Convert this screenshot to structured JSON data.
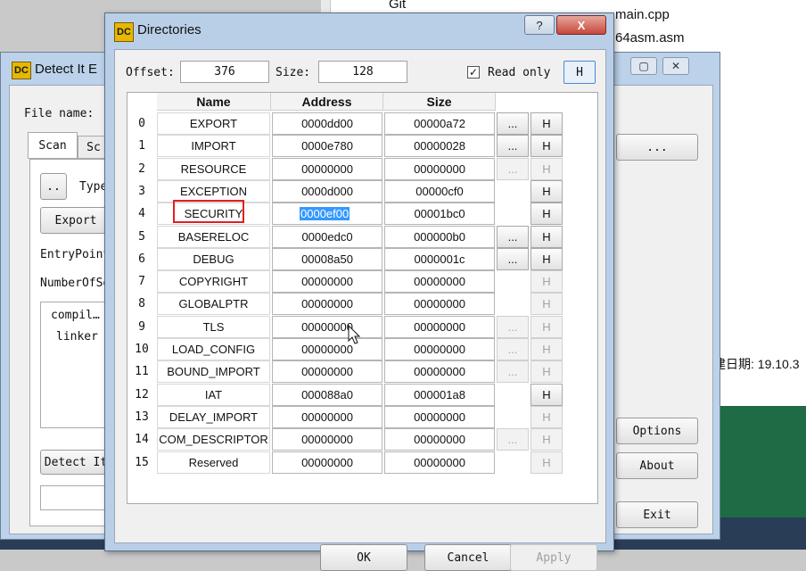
{
  "background": {
    "files": [
      {
        "label": "Git"
      },
      {
        "label": "main.cpp"
      },
      {
        "label": "64asm.asm"
      }
    ],
    "date_text": "建日期: 19.10.3"
  },
  "die_window": {
    "title": "Detect It E",
    "file_name_label": "File name:",
    "tabs": [
      "Scan",
      "Sc"
    ],
    "browse_label": "..",
    "type_label": "Type",
    "export_label": "Export",
    "entrypoint_label": "EntryPoint",
    "numberofsections_label": "NumberOfSe",
    "list_items": [
      "compil…",
      "linker"
    ],
    "detect_label": "Detect It",
    "dots_label": "...",
    "options_label": "Options",
    "about_label": "About",
    "exit_label": "Exit"
  },
  "dialog": {
    "title": "Directories",
    "help_label": "?",
    "close_label": "X",
    "offset_label": "Offset:",
    "offset_value": "376",
    "size_label": "Size:",
    "size_value": "128",
    "readonly_checked": true,
    "readonly_label": "Read only",
    "h_label": "H",
    "columns": [
      "Name",
      "Address",
      "Size"
    ],
    "rows": [
      {
        "idx": "0",
        "name": "EXPORT",
        "address": "0000dd00",
        "size": "00000a72",
        "dots": "enabled",
        "h": "enabled"
      },
      {
        "idx": "1",
        "name": "IMPORT",
        "address": "0000e780",
        "size": "00000028",
        "dots": "enabled",
        "h": "enabled"
      },
      {
        "idx": "2",
        "name": "RESOURCE",
        "address": "00000000",
        "size": "00000000",
        "dots": "disabled",
        "h": "disabled"
      },
      {
        "idx": "3",
        "name": "EXCEPTION",
        "address": "0000d000",
        "size": "00000cf0",
        "dots": "none",
        "h": "enabled"
      },
      {
        "idx": "4",
        "name": "SECURITY",
        "address": "0000ef00",
        "size": "00001bc0",
        "dots": "none",
        "h": "enabled"
      },
      {
        "idx": "5",
        "name": "BASERELOC",
        "address": "0000edc0",
        "size": "000000b0",
        "dots": "enabled",
        "h": "enabled"
      },
      {
        "idx": "6",
        "name": "DEBUG",
        "address": "00008a50",
        "size": "0000001c",
        "dots": "enabled",
        "h": "enabled"
      },
      {
        "idx": "7",
        "name": "COPYRIGHT",
        "address": "00000000",
        "size": "00000000",
        "dots": "none",
        "h": "disabled"
      },
      {
        "idx": "8",
        "name": "GLOBALPTR",
        "address": "00000000",
        "size": "00000000",
        "dots": "none",
        "h": "disabled"
      },
      {
        "idx": "9",
        "name": "TLS",
        "address": "00000000",
        "size": "00000000",
        "dots": "disabled",
        "h": "disabled"
      },
      {
        "idx": "10",
        "name": "LOAD_CONFIG",
        "address": "00000000",
        "size": "00000000",
        "dots": "disabled",
        "h": "disabled"
      },
      {
        "idx": "11",
        "name": "BOUND_IMPORT",
        "address": "00000000",
        "size": "00000000",
        "dots": "disabled",
        "h": "disabled"
      },
      {
        "idx": "12",
        "name": "IAT",
        "address": "000088a0",
        "size": "000001a8",
        "dots": "none",
        "h": "enabled"
      },
      {
        "idx": "13",
        "name": "DELAY_IMPORT",
        "address": "00000000",
        "size": "00000000",
        "dots": "none",
        "h": "disabled"
      },
      {
        "idx": "14",
        "name": "COM_DESCRIPTOR",
        "address": "00000000",
        "size": "00000000",
        "dots": "disabled",
        "h": "disabled"
      },
      {
        "idx": "15",
        "name": "Reserved",
        "address": "00000000",
        "size": "00000000",
        "dots": "none",
        "h": "disabled"
      }
    ],
    "dots_label": "...",
    "ok_label": "OK",
    "cancel_label": "Cancel",
    "apply_label": "Apply",
    "selected_row": "4",
    "highlight_color": "#e02020",
    "selection_color": "#3399ff"
  }
}
